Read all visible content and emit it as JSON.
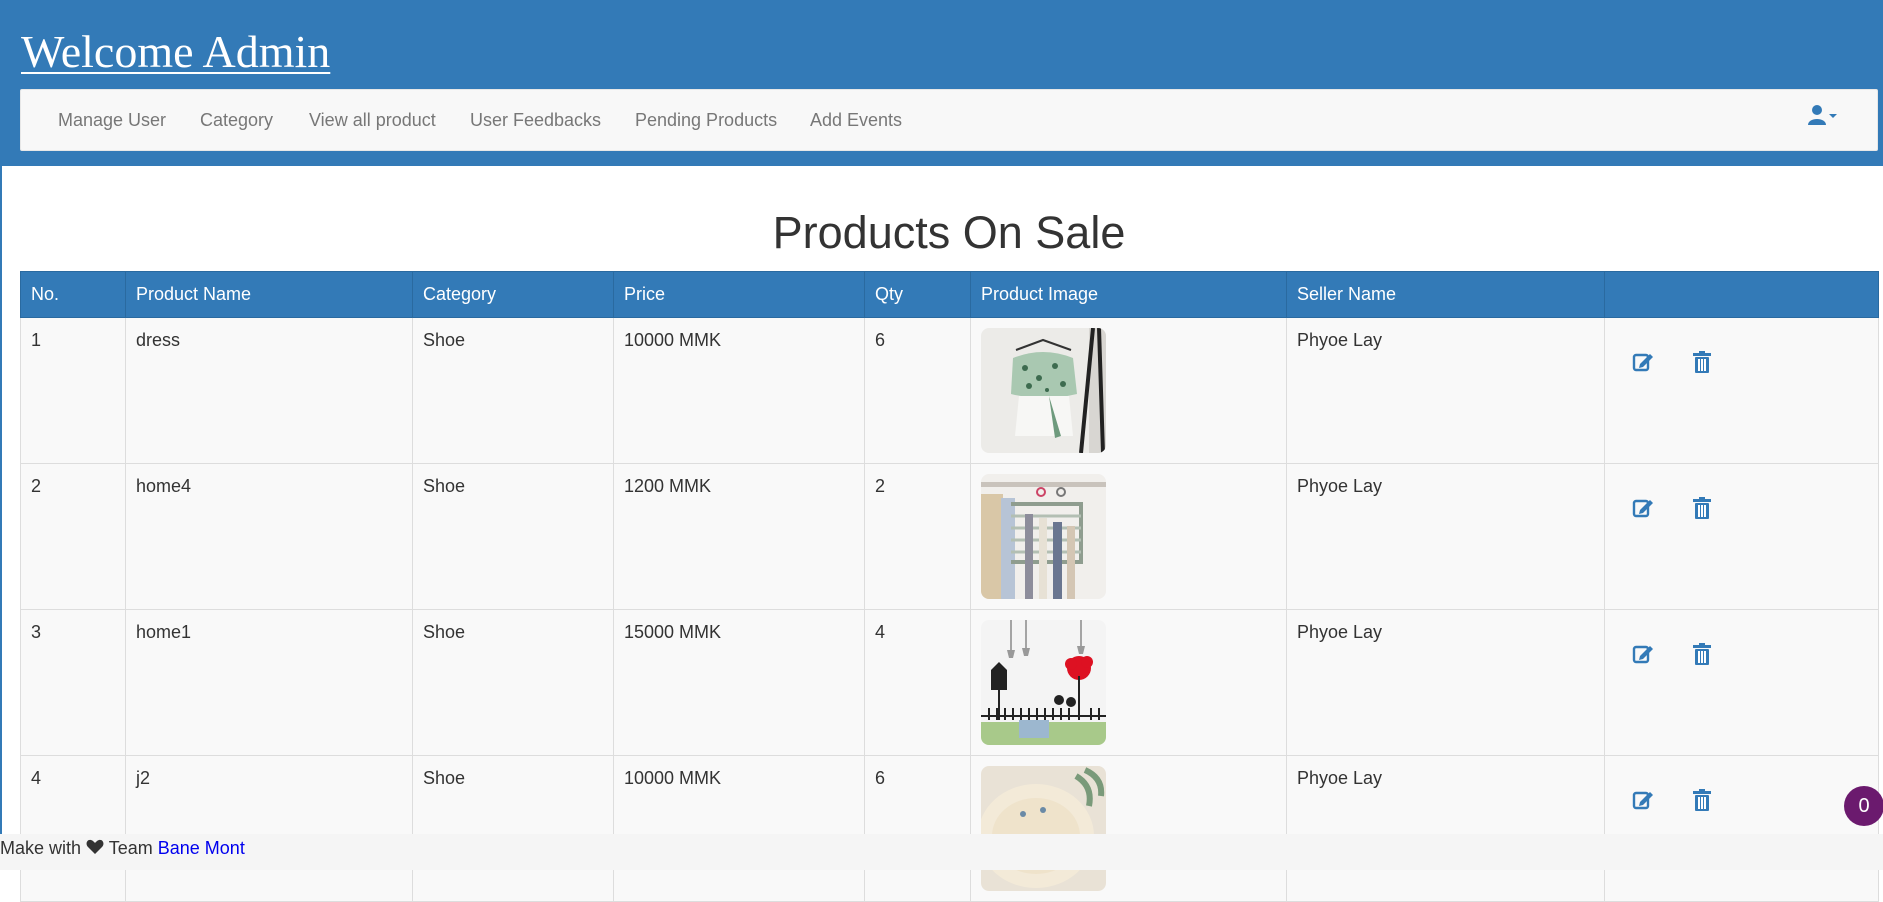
{
  "header": {
    "title": "Welcome Admin"
  },
  "nav": {
    "items": [
      {
        "label": "Manage User"
      },
      {
        "label": "Category"
      },
      {
        "label": "View all product"
      },
      {
        "label": "User Feedbacks"
      },
      {
        "label": "Pending Products"
      },
      {
        "label": "Add Events"
      }
    ],
    "user_menu_icon": "user-icon"
  },
  "main": {
    "title": "Products On Sale",
    "table": {
      "headers": [
        "No.",
        "Product Name",
        "Category",
        "Price",
        "Qty",
        "Product Image",
        "Seller Name",
        ""
      ],
      "rows": [
        {
          "no": "1",
          "name": "dress",
          "category": "Shoe",
          "price": "10000 MMK",
          "qty": "6",
          "image": "dress-photo",
          "seller": "Phyoe Lay"
        },
        {
          "no": "2",
          "name": "home4",
          "category": "Shoe",
          "price": "1200 MMK",
          "qty": "2",
          "image": "hanger-photo",
          "seller": "Phyoe Lay"
        },
        {
          "no": "3",
          "name": "home1",
          "category": "Shoe",
          "price": "15000 MMK",
          "qty": "4",
          "image": "wall-sticker-photo",
          "seller": "Phyoe Lay"
        },
        {
          "no": "4",
          "name": "j2",
          "category": "Shoe",
          "price": "10000 MMK",
          "qty": "6",
          "image": "plate-photo",
          "seller": "Phyoe Lay"
        }
      ],
      "row_actions": {
        "edit_icon": "edit-icon",
        "delete_icon": "trash-icon"
      }
    }
  },
  "footer": {
    "prefix": "Make with",
    "heart_icon": "heart-icon",
    "team_text": "Team",
    "link_text": "Bane Mont"
  },
  "badge": {
    "count": "0"
  },
  "colors": {
    "primary": "#337ab7",
    "navbar_bg": "#f8f8f8",
    "badge": "#6b1a6e"
  }
}
